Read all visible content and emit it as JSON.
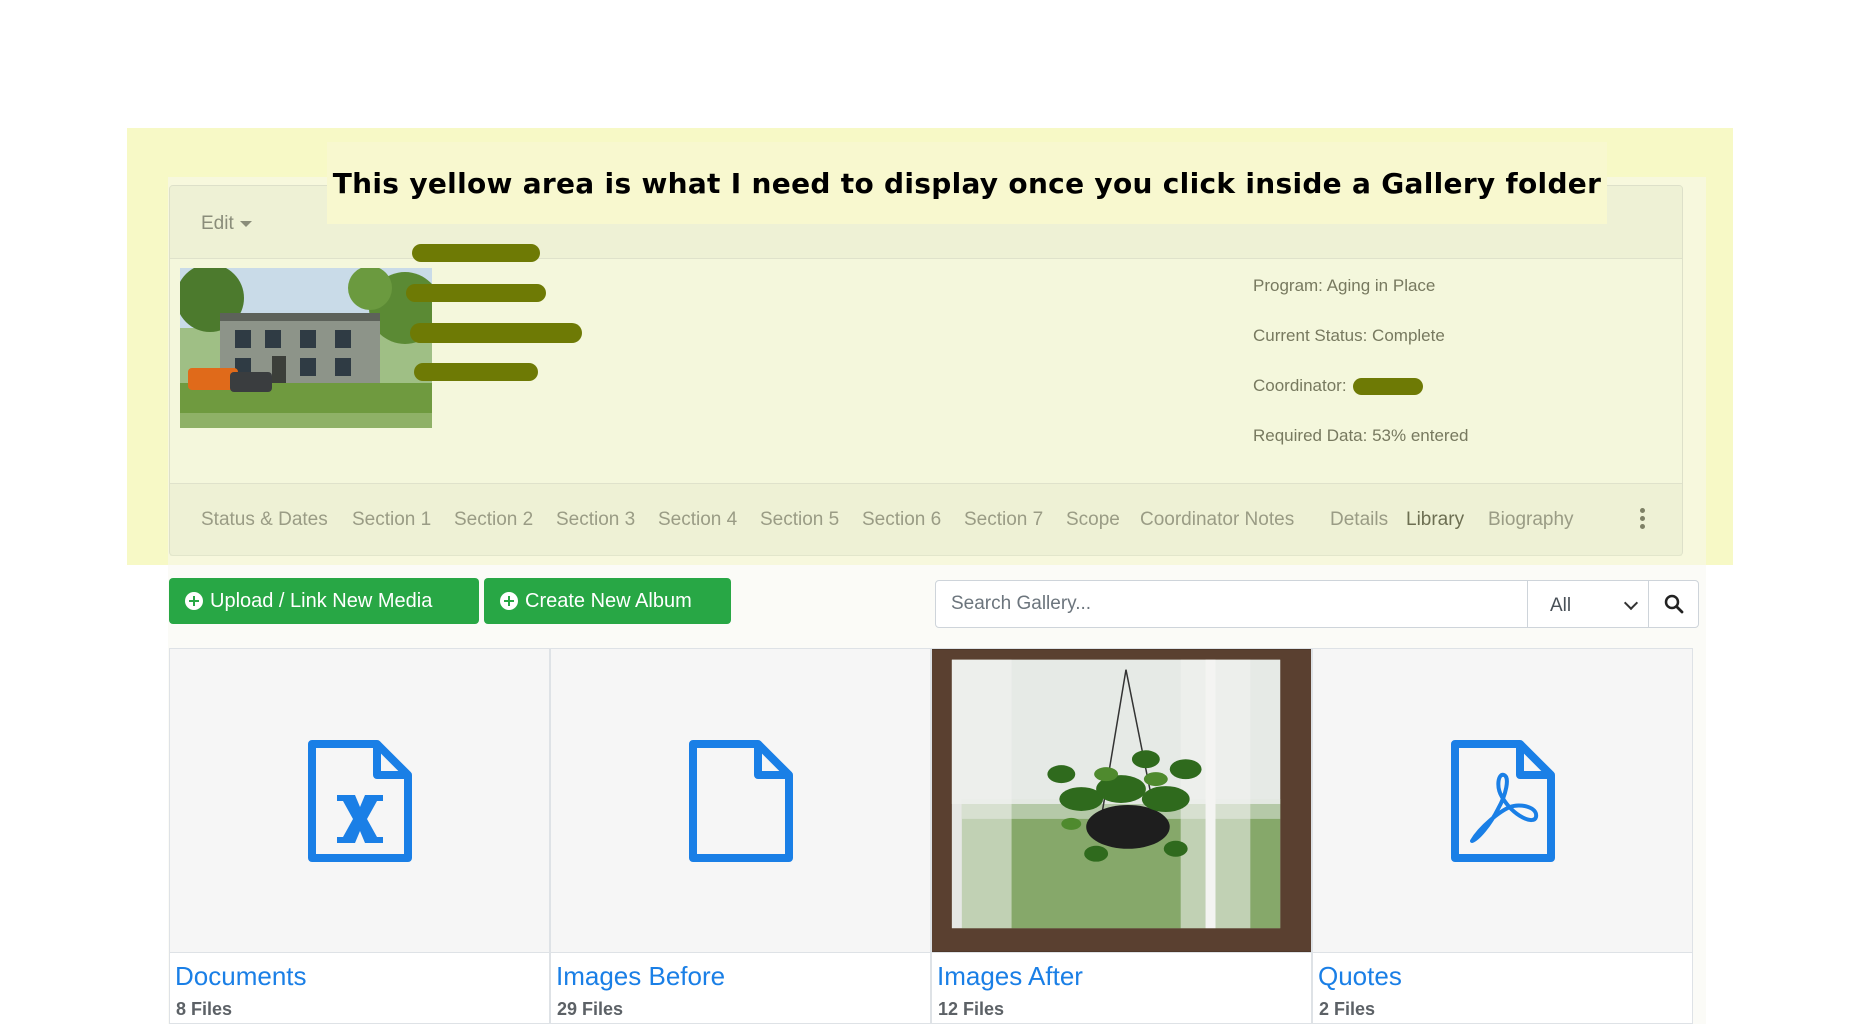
{
  "annotation": "This yellow area is what I need to display once you click inside a Gallery folder",
  "profile": {
    "edit_label": "Edit",
    "info": {
      "program": "Program: Aging in Place",
      "status": "Current Status: Complete",
      "coordinator_label": "Coordinator:",
      "required_data": "Required Data: 53% entered"
    }
  },
  "tabs": [
    {
      "label": "Status & Dates",
      "active": false
    },
    {
      "label": "Section 1",
      "active": false
    },
    {
      "label": "Section 2",
      "active": false
    },
    {
      "label": "Section 3",
      "active": false
    },
    {
      "label": "Section 4",
      "active": false
    },
    {
      "label": "Section 5",
      "active": false
    },
    {
      "label": "Section 6",
      "active": false
    },
    {
      "label": "Section 7",
      "active": false
    },
    {
      "label": "Scope",
      "active": false
    },
    {
      "label": "Coordinator Notes",
      "active": false
    },
    {
      "label": "Details",
      "active": false
    },
    {
      "label": "Library",
      "active": true
    },
    {
      "label": "Biography",
      "active": false
    }
  ],
  "toolbar": {
    "upload_label": "Upload / Link New Media",
    "create_album_label": "Create New Album",
    "search_placeholder": "Search Gallery...",
    "filter_value": "All"
  },
  "albums": [
    {
      "title": "Documents",
      "files_count": 8,
      "files_unit": "Files",
      "thumb": "excel-file-icon"
    },
    {
      "title": "Images Before",
      "files_count": 29,
      "files_unit": "Files",
      "thumb": "blank-file-icon"
    },
    {
      "title": "Images After",
      "files_count": 12,
      "files_unit": "Files",
      "thumb": "plant-photo"
    },
    {
      "title": "Quotes",
      "files_count": 2,
      "files_unit": "Files",
      "thumb": "pdf-file-icon"
    }
  ],
  "colors": {
    "highlight_yellow": "#f7f9c6",
    "button_green": "#28a745",
    "link_blue": "#1a7fe6",
    "redaction": "#6e7a05"
  }
}
